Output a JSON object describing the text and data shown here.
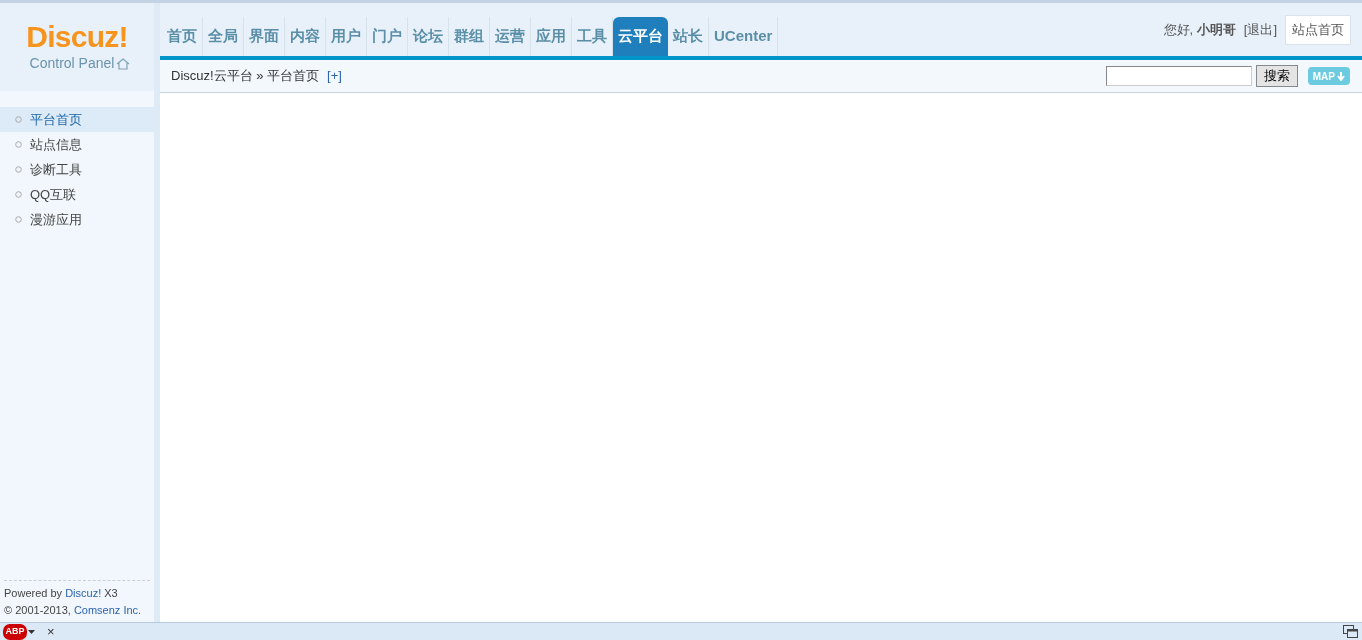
{
  "logo": {
    "brand": "Discuz!",
    "subtitle": "Control Panel"
  },
  "nav": [
    {
      "label": "首页",
      "selected": false
    },
    {
      "label": "全局",
      "selected": false
    },
    {
      "label": "界面",
      "selected": false
    },
    {
      "label": "内容",
      "selected": false
    },
    {
      "label": "用户",
      "selected": false
    },
    {
      "label": "门户",
      "selected": false
    },
    {
      "label": "论坛",
      "selected": false
    },
    {
      "label": "群组",
      "selected": false
    },
    {
      "label": "运营",
      "selected": false
    },
    {
      "label": "应用",
      "selected": false
    },
    {
      "label": "工具",
      "selected": false
    },
    {
      "label": "云平台",
      "selected": true
    },
    {
      "label": "站长",
      "selected": false
    },
    {
      "label": "UCenter",
      "selected": false
    }
  ],
  "user": {
    "greeting": "您好, **小明哥**",
    "logout": "[退出]",
    "home_button": "站点首页"
  },
  "breadcrumb": {
    "path": "Discuz!云平台 » 平台首页",
    "add": "[+]"
  },
  "search": {
    "button": "搜索",
    "map_button": "MAP"
  },
  "sidebar": {
    "items": [
      {
        "label": "平台首页",
        "selected": true
      },
      {
        "label": "站点信息",
        "selected": false
      },
      {
        "label": "诊断工具",
        "selected": false
      },
      {
        "label": "QQ互联",
        "selected": false
      },
      {
        "label": "漫游应用",
        "selected": false
      }
    ]
  },
  "footer": {
    "powered_prefix": "Powered by",
    "powered_link": "Discuz!",
    "powered_suffix": "X3",
    "copyright_prefix": "© 2001-2013,",
    "copyright_link": "Comsenz Inc."
  },
  "status_bar": {
    "adblock_label": "ABP",
    "close": "×"
  }
}
